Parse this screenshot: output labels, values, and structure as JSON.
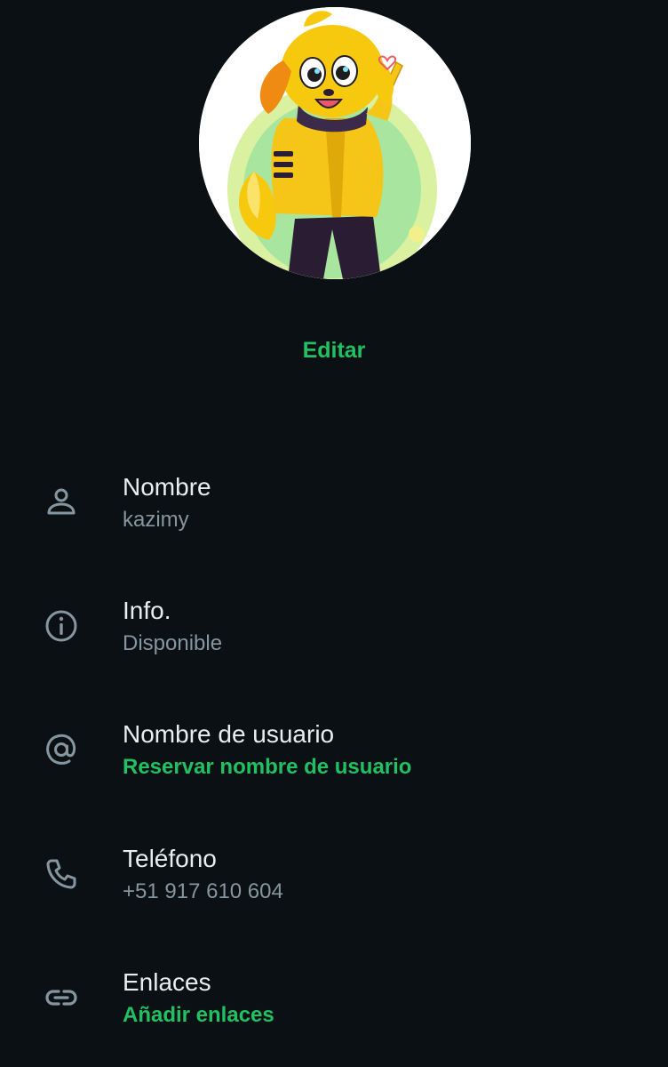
{
  "profile": {
    "edit_label": "Editar",
    "fields": [
      {
        "icon": "person-icon",
        "title": "Nombre",
        "value": "kazimy"
      },
      {
        "icon": "info-icon",
        "title": "Info.",
        "value": "Disponible"
      },
      {
        "icon": "at-icon",
        "title": "Nombre de usuario",
        "value": "Reservar nombre de usuario"
      },
      {
        "icon": "phone-icon",
        "title": "Teléfono",
        "value": "+51 917 610 604"
      },
      {
        "icon": "link-icon",
        "title": "Enlaces",
        "value": "Añadir enlaces"
      }
    ]
  },
  "colors": {
    "background": "#0b1014",
    "accent": "#21c063",
    "primary_text": "#e9edef",
    "secondary_text": "#8696a0",
    "icon": "#8696a0"
  }
}
